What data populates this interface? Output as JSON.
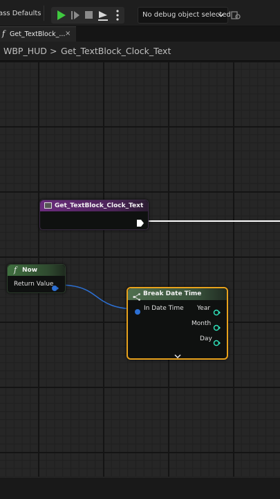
{
  "toolbar": {
    "class_defaults_label": "ass Defaults",
    "debug_object": "No debug object selected"
  },
  "tab": {
    "icon_glyph": "f",
    "label": "Get_TextBlock_...",
    "close_glyph": "×"
  },
  "breadcrumb": {
    "root": "WBP_HUD",
    "separator": ">",
    "current": "Get_TextBlock_Clock_Text"
  },
  "nodes": {
    "get_function": {
      "title": "Get_TextBlock_Clock_Text",
      "header_color": "#6b2c7e"
    },
    "now": {
      "icon_glyph": "f",
      "title": "Now",
      "output_pin": "Return Value",
      "header_color": "#3f6f3f"
    },
    "break_date_time": {
      "title": "Break Date Time",
      "input_pin": "In Date Time",
      "output_pins": [
        "Year",
        "Month",
        "Day"
      ],
      "expand_glyph": "⌄",
      "header_color": "#4f6f4f",
      "selection_color": "#e8a21c"
    }
  },
  "colors": {
    "play_green": "#3fc93f",
    "struct_pin_blue": "#2c70d4",
    "int_pin_teal": "#2fe0b8",
    "exec_white": "#ffffff"
  }
}
